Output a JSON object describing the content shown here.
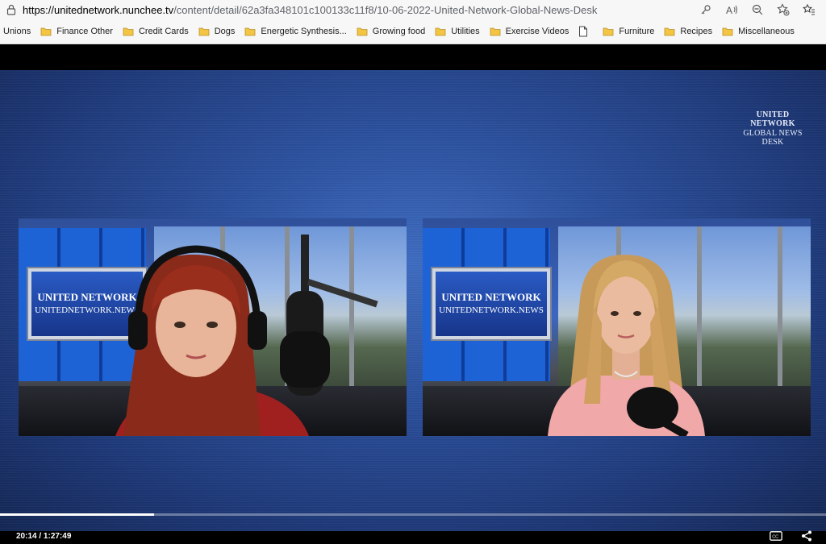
{
  "browser": {
    "url_host": "https://unitednetwork.nunchee.tv",
    "url_path": "/content/detail/62a3fa348101c100133c11f8/10-06-2022-United-Network-Global-News-Desk",
    "address_icons": [
      "key-icon",
      "read-aloud-icon",
      "zoom-out-icon",
      "favorite-add-icon",
      "favorites-icon"
    ]
  },
  "bookmarks": [
    {
      "label": "Unions",
      "icon": "none"
    },
    {
      "label": "Finance Other",
      "icon": "folder-icon"
    },
    {
      "label": "Credit Cards",
      "icon": "folder-icon"
    },
    {
      "label": "Dogs",
      "icon": "folder-icon"
    },
    {
      "label": "Energetic Synthesis...",
      "icon": "folder-icon"
    },
    {
      "label": "Growing food",
      "icon": "folder-icon"
    },
    {
      "label": "Utilities",
      "icon": "folder-icon"
    },
    {
      "label": "Exercise Videos",
      "icon": "folder-icon"
    },
    {
      "label": "",
      "icon": "page-icon"
    },
    {
      "label": "Furniture",
      "icon": "folder-icon"
    },
    {
      "label": "Recipes",
      "icon": "folder-icon"
    },
    {
      "label": "Miscellaneous",
      "icon": "folder-icon"
    }
  ],
  "video": {
    "logo_line1": "UNITED NETWORK",
    "logo_line2": "GLOBAL NEWS DESK",
    "sign_line1": "UNITED NETWORK",
    "sign_line2": "UNITEDNETWORK.NEWS",
    "current_time": "20:14",
    "separator": "/",
    "duration": "1:27:49",
    "progress_fraction": 0.1865
  },
  "colors": {
    "folder": "#f4c542",
    "progress": "#ffffff"
  }
}
